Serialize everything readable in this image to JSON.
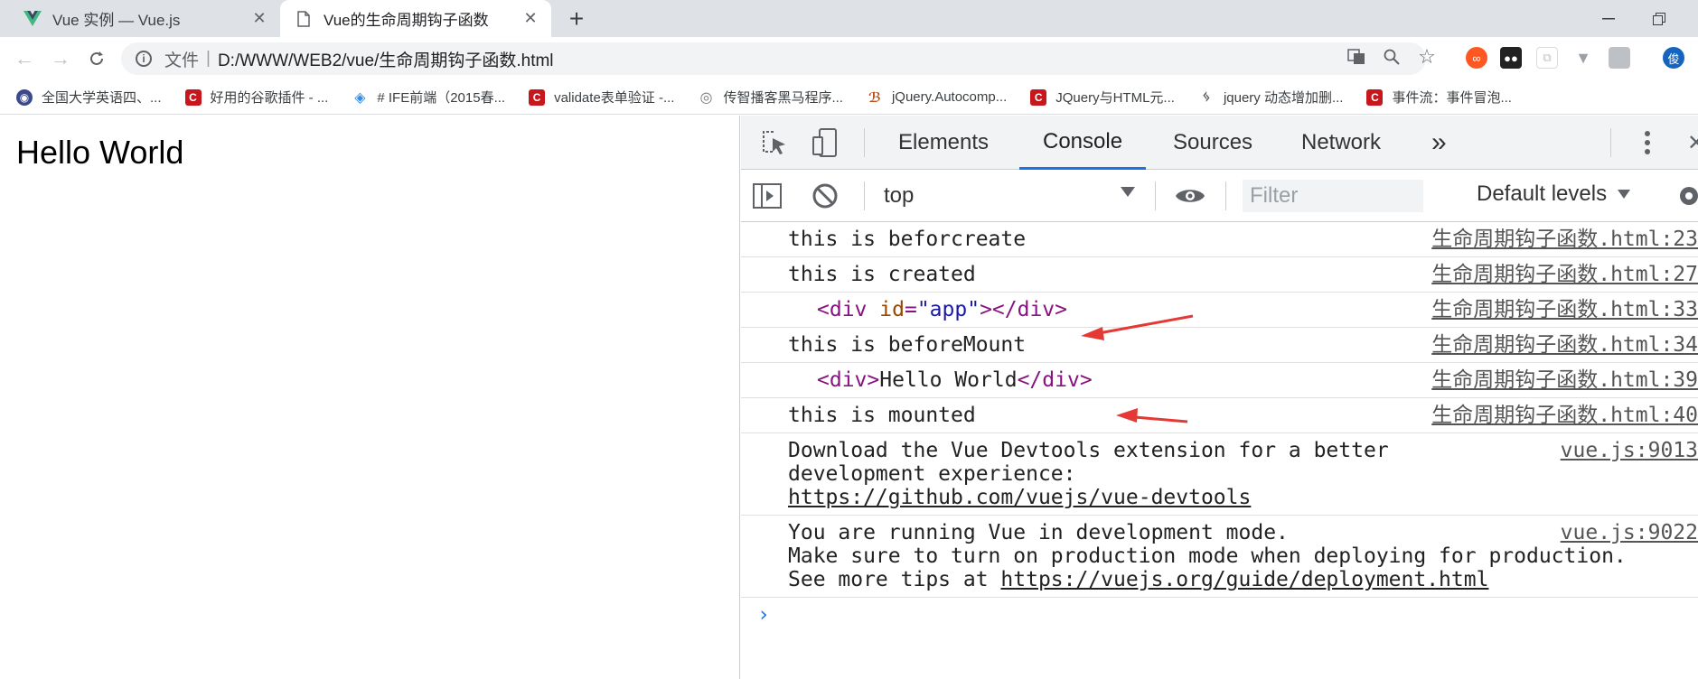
{
  "tabs": [
    {
      "label": "Vue 实例 — Vue.js",
      "favicon": "vue-logo-icon",
      "active": false
    },
    {
      "label": "Vue的生命周期钩子函数",
      "favicon": "document-icon",
      "active": true
    }
  ],
  "address_bar": {
    "scheme_label": "文件",
    "separator": "|",
    "url": "D:/WWW/WEB2/vue/生命周期钩子函数.html"
  },
  "bookmarks": [
    {
      "label": "全国大学英语四、...",
      "icon": "globe-icon",
      "color": "#3b4a8c"
    },
    {
      "label": "好用的谷歌插件 - ...",
      "icon": "csdn-icon",
      "color": "#c8161d"
    },
    {
      "label": "# IFE前端（2015春...",
      "icon": "layers-icon",
      "color": "#2d8cf0"
    },
    {
      "label": "validate表单验证 -...",
      "icon": "csdn-icon",
      "color": "#c8161d"
    },
    {
      "label": "传智播客黑马程序...",
      "icon": "globe-outline-icon",
      "color": "#777777"
    },
    {
      "label": "jQuery.Autocomp...",
      "icon": "jquery-icon",
      "color": "#b3541e"
    },
    {
      "label": "JQuery与HTML元...",
      "icon": "csdn-icon",
      "color": "#c8161d"
    },
    {
      "label": "jquery 动态增加删...",
      "icon": "runner-icon",
      "color": "#555555"
    },
    {
      "label": "事件流：事件冒泡...",
      "icon": "csdn-icon",
      "color": "#c8161d"
    }
  ],
  "page": {
    "heading": "Hello World"
  },
  "devtools": {
    "tabs": [
      "Elements",
      "Console",
      "Sources",
      "Network"
    ],
    "active_tab": "Console",
    "more_tabs": "»",
    "context": "top",
    "filter_placeholder": "Filter",
    "levels": "Default levels",
    "accent": "#1a73e8",
    "messages": [
      {
        "text": "this is beforcreate",
        "source": "生命周期钩子函数.html:23"
      },
      {
        "text": "this is created",
        "source": "生命周期钩子函数.html:27"
      },
      {
        "element": {
          "open": "<div",
          "attr": "id",
          "eq": "=",
          "val": "\"app\"",
          "close": "></div>"
        },
        "source": "生命周期钩子函数.html:33"
      },
      {
        "text": "this is beforeMount",
        "source": "生命周期钩子函数.html:34"
      },
      {
        "element2": {
          "open": "<div>",
          "content": "Hello World",
          "close": "</div>"
        },
        "source": "生命周期钩子函数.html:39"
      },
      {
        "text": "this is mounted",
        "source": "生命周期钩子函数.html:40"
      },
      {
        "lines": [
          "Download the Vue Devtools extension for a better",
          "development experience:"
        ],
        "link": "https://github.com/vuejs/vue-devtools",
        "source": "vue.js:9013"
      },
      {
        "lines": [
          "You are running Vue in development mode.",
          "Make sure to turn on production mode when deploying for production."
        ],
        "prefix": "See more tips at ",
        "link": "https://vuejs.org/guide/deployment.html",
        "source": "vue.js:9022"
      }
    ]
  },
  "annotation_color": "#e53935"
}
